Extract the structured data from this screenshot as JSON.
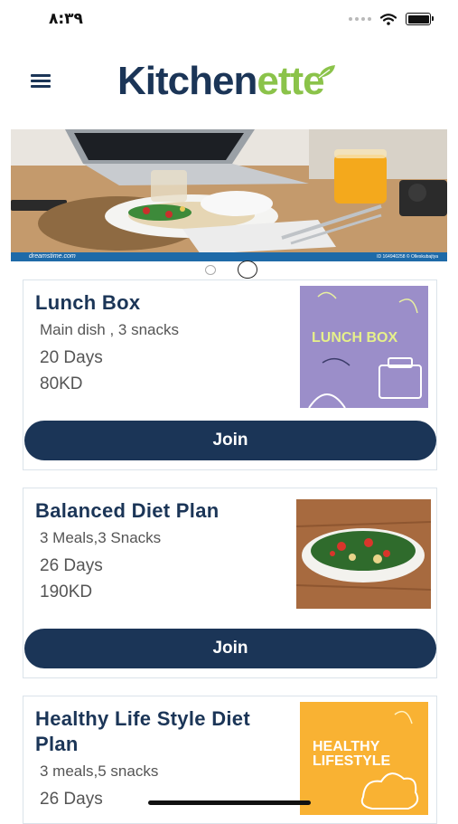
{
  "status_bar": {
    "time": "٨:٣٩"
  },
  "header": {
    "logo_main": "Kitchen",
    "logo_accent": "ette"
  },
  "banner": {
    "watermark": "dreamstime.com",
    "credit": "ID 164940258 © Olleskubajtya"
  },
  "plans": [
    {
      "title": "Lunch Box",
      "description": "Main dish , 3 snacks",
      "duration": "20 Days",
      "price": "80KD",
      "button": "Join",
      "image_text": "LUNCH BOX"
    },
    {
      "title": "Balanced Diet Plan",
      "description": "3 Meals,3 Snacks",
      "duration": "26 Days",
      "price": "190KD",
      "button": "Join"
    },
    {
      "title": "Healthy Life Style Diet Plan",
      "title_line1": "Healthy Life Style Diet",
      "title_line2": "Plan",
      "description": "3 meals,5 snacks",
      "duration": "26 Days",
      "image_text_line1": "HEALTHY",
      "image_text_line2": "LIFESTYLE"
    }
  ],
  "colors": {
    "brand_navy": "#1b3557",
    "brand_green": "#8bc34a",
    "lunch_purple": "#9b8ec9",
    "healthy_yellow": "#f9b233"
  },
  "icons": {
    "menu": "hamburger-icon",
    "wifi": "wifi-icon",
    "battery": "battery-icon"
  }
}
